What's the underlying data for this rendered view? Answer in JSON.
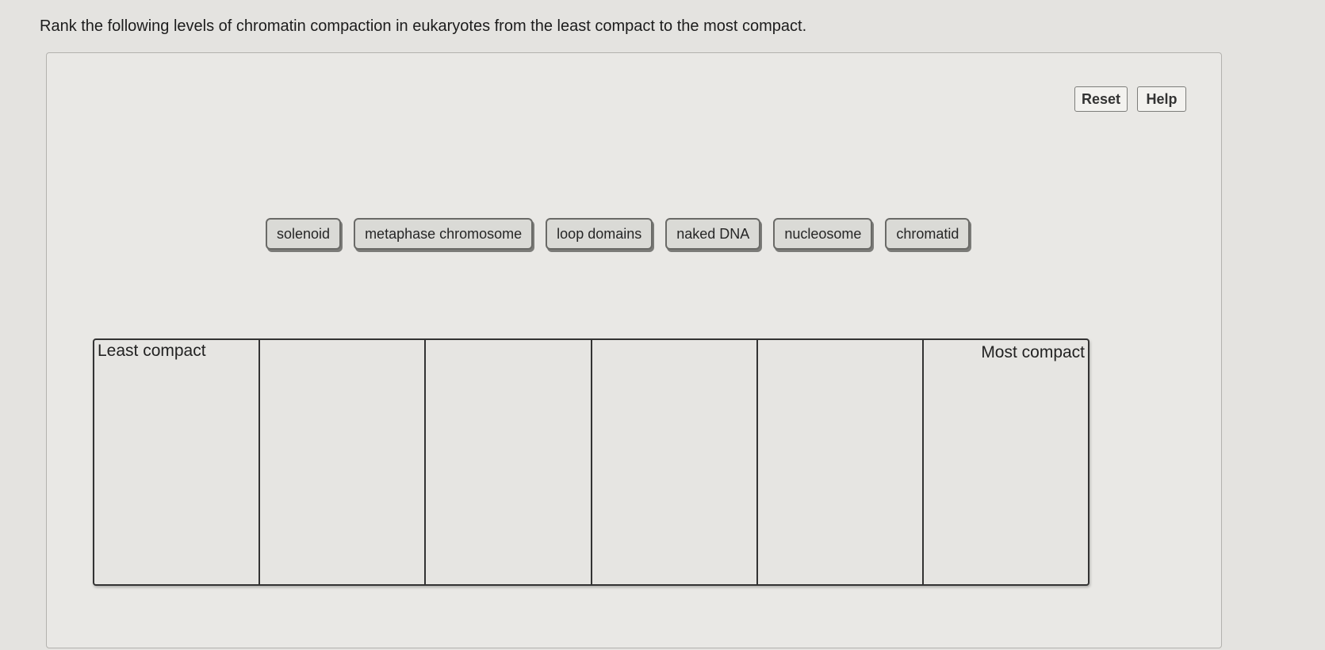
{
  "question": "Rank the following levels of chromatin compaction in eukaryotes from the least compact to the most compact.",
  "toolbar": {
    "reset_label": "Reset",
    "help_label": "Help"
  },
  "items": [
    {
      "label": "solenoid"
    },
    {
      "label": "metaphase chromosome"
    },
    {
      "label": "loop domains"
    },
    {
      "label": "naked DNA"
    },
    {
      "label": "nucleosome"
    },
    {
      "label": "chromatid"
    }
  ],
  "ranking": {
    "least_label": "Least compact",
    "most_label": "Most compact",
    "slots": 6
  }
}
